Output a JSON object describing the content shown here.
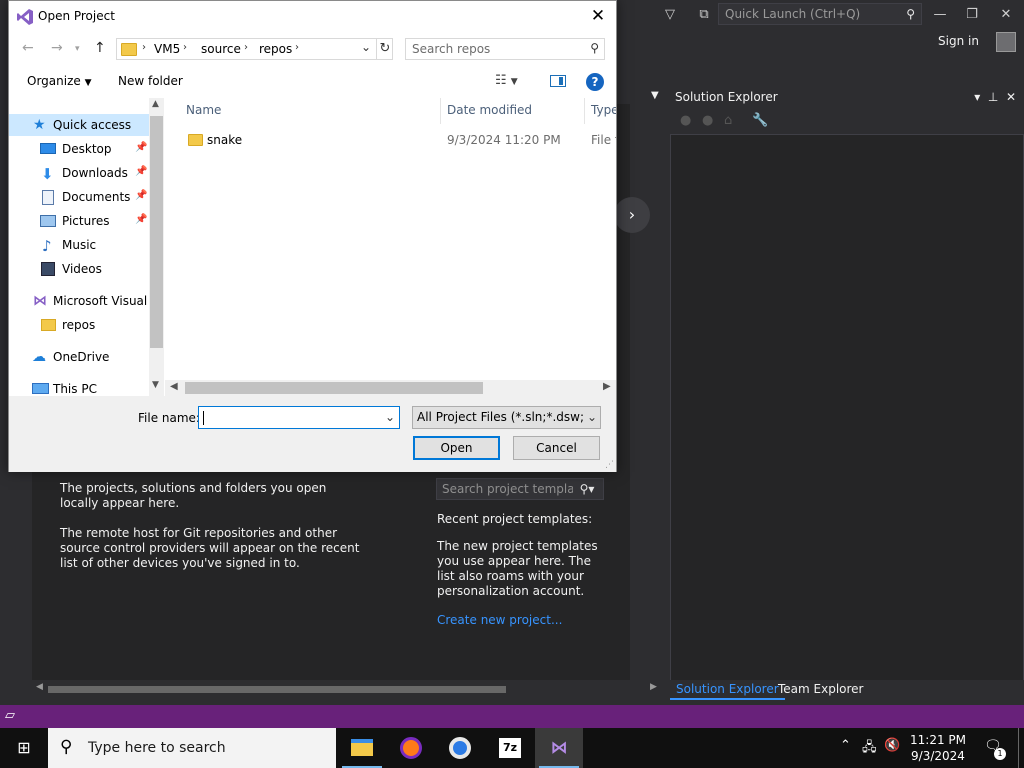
{
  "vs": {
    "quick_launch": "Quick Launch (Ctrl+Q)",
    "sign_in": "Sign in",
    "recent_text_1": "The projects, solutions and folders you open locally appear here.",
    "recent_text_2": "The remote host for Git repositories and other source control providers will appear on the recent list of other devices you've signed in to.",
    "search_templates": "Search project templates",
    "recent_templates_heading": "Recent project templates:",
    "templates_text": "The new project templates you use appear here. The list also roams with your personalization account.",
    "create_new_project": "Create new project...",
    "solution_explorer_title": "Solution Explorer",
    "tab_solution_explorer": "Solution Explorer",
    "tab_team_explorer": "Team Explorer",
    "accent": "#68217a",
    "link_color": "#3794ff"
  },
  "dialog": {
    "title": "Open Project",
    "address": [
      "VM5",
      "source",
      "repos"
    ],
    "search_placeholder": "Search repos",
    "organize": "Organize",
    "new_folder": "New folder",
    "nav": [
      {
        "label": "Quick access",
        "icon": "star-icon"
      },
      {
        "label": "Desktop",
        "icon": "desktop-icon",
        "pinned": true
      },
      {
        "label": "Downloads",
        "icon": "download-icon",
        "pinned": true
      },
      {
        "label": "Documents",
        "icon": "document-icon",
        "pinned": true
      },
      {
        "label": "Pictures",
        "icon": "picture-icon",
        "pinned": true
      },
      {
        "label": "Music",
        "icon": "music-icon"
      },
      {
        "label": "Videos",
        "icon": "video-icon"
      },
      {
        "label": "Microsoft Visual S",
        "icon": "visual-studio-icon"
      },
      {
        "label": "repos",
        "icon": "folder-icon"
      },
      {
        "label": "OneDrive",
        "icon": "cloud-icon"
      },
      {
        "label": "This PC",
        "icon": "computer-icon"
      }
    ],
    "columns": {
      "name": "Name",
      "date": "Date modified",
      "type": "Type"
    },
    "files": [
      {
        "name": "snake",
        "date": "9/3/2024 11:20 PM",
        "type": "File fo"
      }
    ],
    "file_name_label": "File name:",
    "file_name_value": "",
    "filter": "All Project Files (*.sln;*.dsw;*.vc",
    "open": "Open",
    "cancel": "Cancel"
  },
  "taskbar": {
    "search_text": "Type here to search",
    "time": "11:21 PM",
    "date": "9/3/2024",
    "notification_count": "1"
  }
}
